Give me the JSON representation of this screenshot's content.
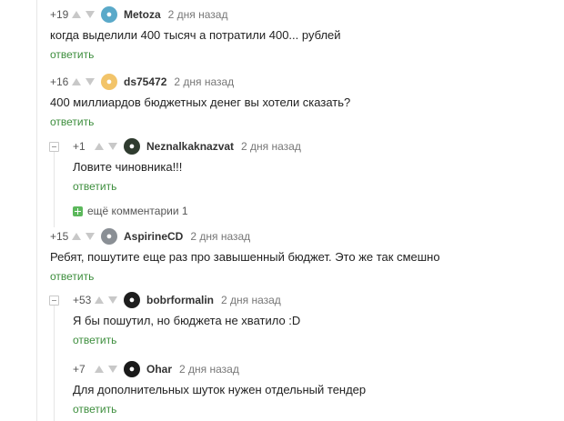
{
  "comments": [
    {
      "rating": "+19",
      "author": "Metoza",
      "time": "2 дня назад",
      "text": "когда выделили 400 тысяч а потратили 400... рублей",
      "reply": "ответить",
      "avatar_color": "#5aa9c9",
      "avatar_icon": "dog-avatar-icon"
    },
    {
      "rating": "+16",
      "author": "ds75472",
      "time": "2 дня назад",
      "text": "400 миллиардов бюджетных денег вы хотели сказать?",
      "reply": "ответить",
      "avatar_color": "#f2c46a",
      "avatar_icon": "bear-avatar-icon"
    },
    {
      "rating": "+1",
      "author": "Neznalkaknazvat",
      "time": "2 дня назад",
      "text": "Ловите чиновника!!!",
      "reply": "ответить",
      "avatar_color": "#2f3b2f",
      "avatar_icon": "face-avatar-icon"
    },
    {
      "rating": "+15",
      "author": "AspirineCD",
      "time": "2 дня назад",
      "text": "Ребят, пошутите еще раз про завышенный бюджет. Это же так смешно",
      "reply": "ответить",
      "avatar_color": "#8a8f95",
      "avatar_icon": "figure-avatar-icon"
    },
    {
      "rating": "+53",
      "author": "bobrformalin",
      "time": "2 дня назад",
      "text": "Я бы пошутил, но бюджета не хватило :D",
      "reply": "ответить",
      "avatar_color": "#1e1e1e",
      "avatar_icon": "dark-avatar-icon"
    },
    {
      "rating": "+7",
      "author": "Ohar",
      "time": "2 дня назад",
      "text": "Для дополнительных шуток нужен отдельный тендер",
      "reply": "ответить",
      "avatar_color": "#1a1a1a",
      "avatar_icon": "skull-avatar-icon"
    }
  ],
  "more_comments": {
    "label": "ещё комментарии",
    "count": "1"
  },
  "colors": {
    "reply_link": "#3d8e3d",
    "more_plus": "#5cb85c",
    "vote_arrows": "#c8c8c8"
  }
}
